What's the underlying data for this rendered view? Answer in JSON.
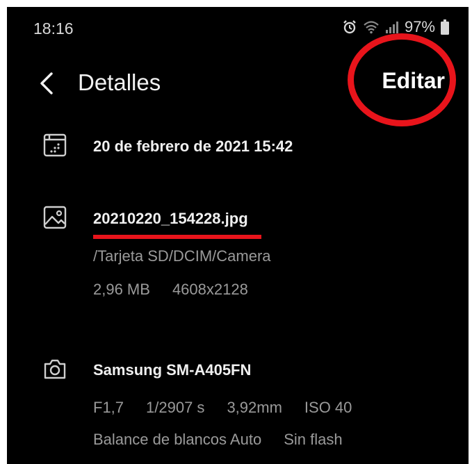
{
  "status_bar": {
    "time": "18:16",
    "battery": "97%",
    "icons": [
      "alarm-icon",
      "wifi-icon",
      "signal-icon",
      "battery-icon"
    ]
  },
  "header": {
    "back_icon": "chevron-left-icon",
    "title": "Detalles",
    "edit_label": "Editar"
  },
  "date_row": {
    "icon": "calendar-icon",
    "value": "20 de febrero de 2021 15:42"
  },
  "file_row": {
    "icon": "image-icon",
    "filename": "20210220_154228.jpg",
    "path": "/Tarjeta SD/DCIM/Camera",
    "size": "2,96 MB",
    "resolution": "4608x2128"
  },
  "camera_row": {
    "icon": "camera-icon",
    "model": "Samsung SM-A405FN",
    "aperture": "F1,7",
    "shutter": "1/2907 s",
    "focal_length": "3,92mm",
    "iso": "ISO 40",
    "white_balance": "Balance de blancos Auto",
    "flash": "Sin flash"
  },
  "colors": {
    "background": "#000000",
    "annotation_red": "#e8141b",
    "primary_text": "#f0f0f0",
    "secondary_text": "#9a9a9a"
  }
}
